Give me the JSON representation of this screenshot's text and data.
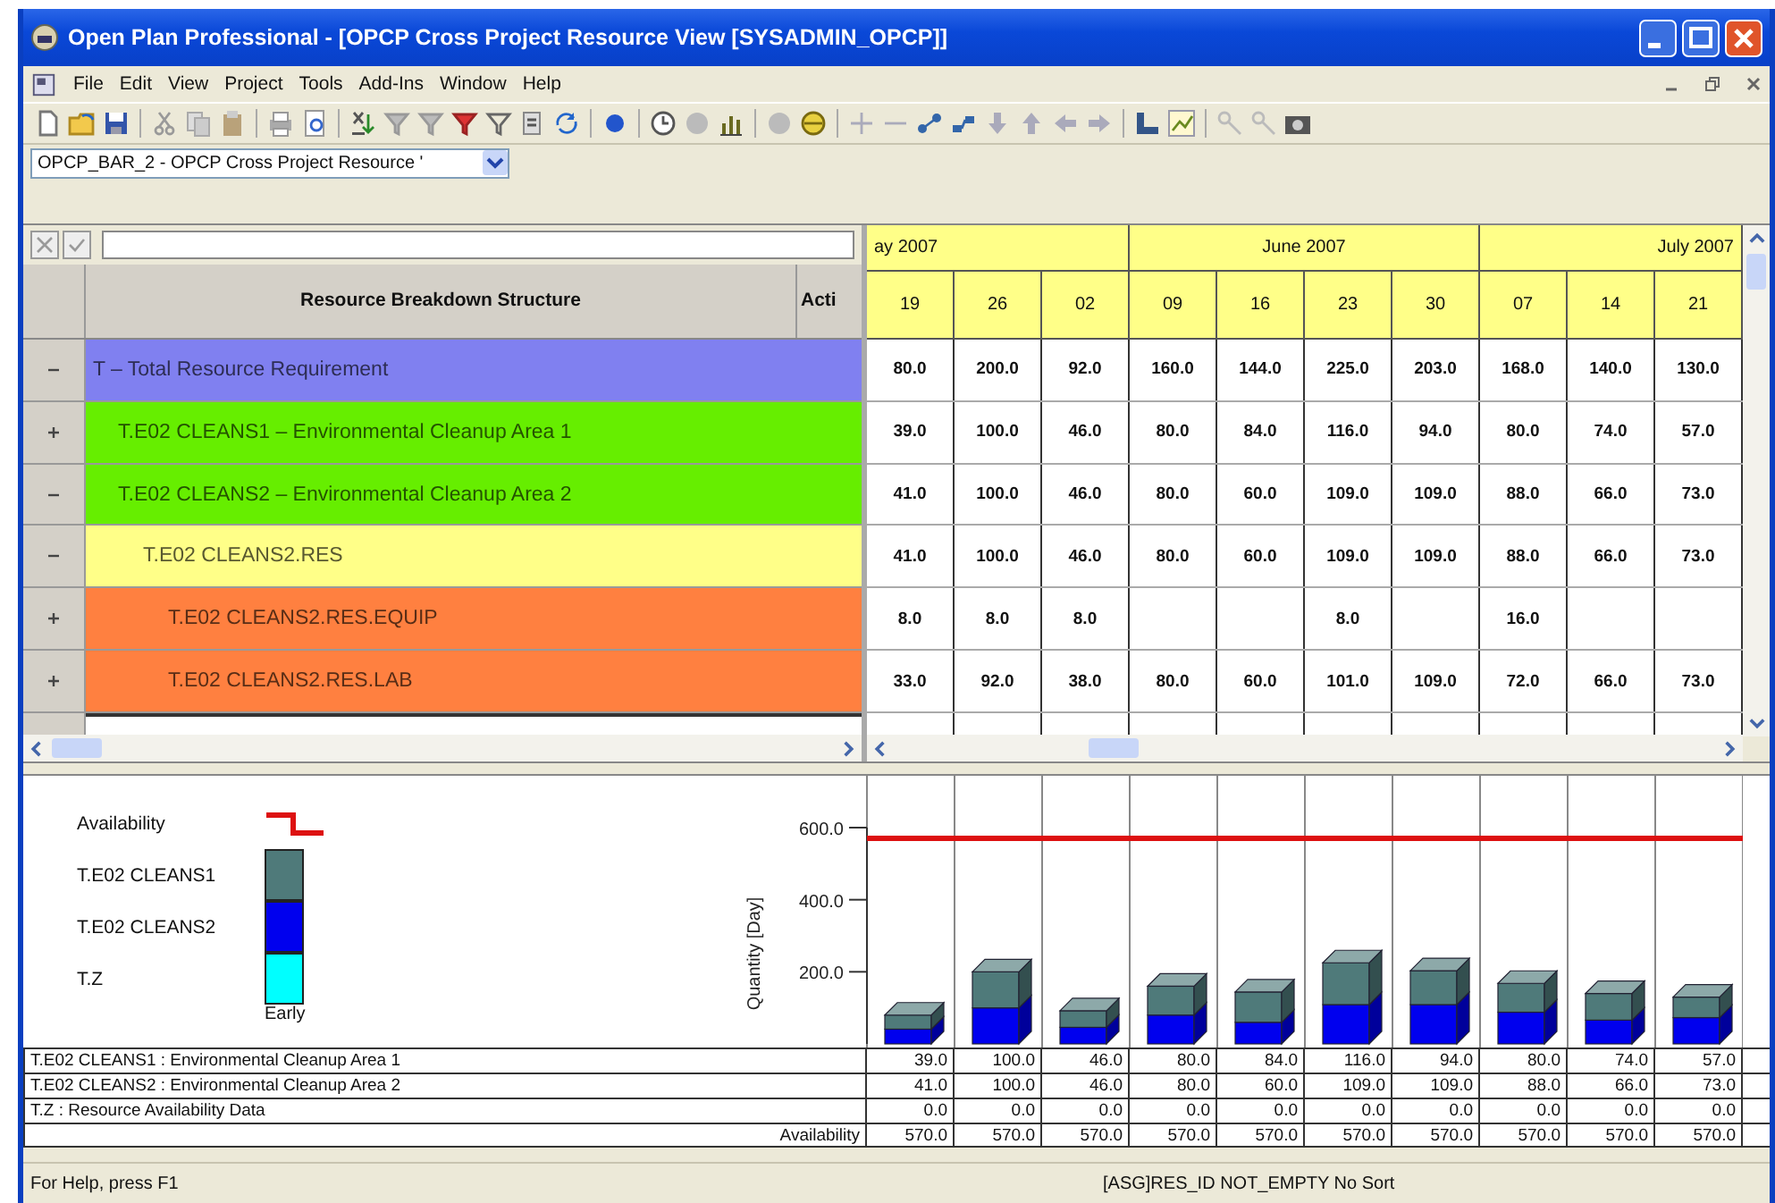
{
  "window": {
    "title": "Open Plan Professional - [OPCP Cross Project Resource View [SYSADMIN_OPCP]]"
  },
  "menu": [
    "File",
    "Edit",
    "View",
    "Project",
    "Tools",
    "Add-Ins",
    "Window",
    "Help"
  ],
  "view_selector": {
    "value": "OPCP_BAR_2 - OPCP Cross Project Resource '"
  },
  "resource_grid": {
    "columns": [
      "Resource Breakdown Structure",
      "Acti"
    ],
    "rows": [
      {
        "label": "T – Total Resource Requirement",
        "color": "#8080f0",
        "expanded": true,
        "values": [
          "80.0",
          "200.0",
          "92.0",
          "160.0",
          "144.0",
          "225.0",
          "203.0",
          "168.0",
          "140.0",
          "130.0"
        ],
        "children": [
          {
            "label": "T.E02 CLEANS1 – Environmental Cleanup Area 1",
            "color": "#66ee00",
            "expanded": false,
            "values": [
              "39.0",
              "100.0",
              "46.0",
              "80.0",
              "84.0",
              "116.0",
              "94.0",
              "80.0",
              "74.0",
              "57.0"
            ]
          },
          {
            "label": "T.E02 CLEANS2 – Environmental Cleanup Area 2",
            "color": "#66ee00",
            "expanded": true,
            "values": [
              "41.0",
              "100.0",
              "46.0",
              "80.0",
              "60.0",
              "109.0",
              "109.0",
              "88.0",
              "66.0",
              "73.0"
            ],
            "children": [
              {
                "label": "T.E02 CLEANS2.RES",
                "color": "#ffff88",
                "expanded": true,
                "values": [
                  "41.0",
                  "100.0",
                  "46.0",
                  "80.0",
                  "60.0",
                  "109.0",
                  "109.0",
                  "88.0",
                  "66.0",
                  "73.0"
                ],
                "children": [
                  {
                    "label": "T.E02 CLEANS2.RES.EQUIP",
                    "color": "#ff8040",
                    "expanded": false,
                    "values": {
                      "0": "8.0",
                      "1": "8.0",
                      "2": "8.0",
                      "5": "8.0",
                      "7": "16.0"
                    }
                  },
                  {
                    "label": "T.E02 CLEANS2.RES.LAB",
                    "color": "#ff8040",
                    "expanded": false,
                    "values": [
                      "33.0",
                      "92.0",
                      "38.0",
                      "80.0",
                      "60.0",
                      "101.0",
                      "109.0",
                      "72.0",
                      "66.0",
                      "73.0"
                    ]
                  }
                ]
              }
            ]
          }
        ]
      }
    ]
  },
  "timescale": {
    "months": [
      {
        "label": "ay 2007",
        "weeks": [
          "19",
          "26",
          "02"
        ]
      },
      {
        "label": "June 2007",
        "weeks": [
          "09",
          "16",
          "23",
          "30"
        ]
      },
      {
        "label": "July 2007",
        "weeks": [
          "07",
          "14",
          "21"
        ]
      }
    ]
  },
  "histogram": {
    "legend_caption": "Early",
    "chart_data": {
      "type": "bar",
      "stacked": true,
      "ylabel": "Quantity [Day]",
      "ylim": [
        0,
        600
      ],
      "yticks": [
        {
          "value": 200,
          "label": "200.0"
        },
        {
          "value": 400,
          "label": "400.0"
        },
        {
          "value": 600,
          "label": "600.0"
        }
      ],
      "ref_lines": [
        {
          "axis": "y",
          "value": 570,
          "label": "Availability",
          "color": "#dd1111"
        }
      ],
      "series": [
        {
          "name": "T.E02 CLEANS1",
          "color": "#4f7a7a",
          "values": [
            39,
            100,
            46,
            80,
            84,
            116,
            94,
            80,
            74,
            57
          ]
        },
        {
          "name": "T.E02 CLEANS2",
          "color": "#0000ee",
          "values": [
            41,
            100,
            46,
            80,
            60,
            109,
            109,
            88,
            66,
            73
          ]
        },
        {
          "name": "T.Z",
          "color": "#00ffff",
          "values": [
            0,
            0,
            0,
            0,
            0,
            0,
            0,
            0,
            0,
            0
          ]
        }
      ]
    },
    "table": [
      {
        "kind": "series",
        "label": "T.E02 CLEANS1 : Environmental Cleanup Area 1",
        "values": [
          "39.0",
          "100.0",
          "46.0",
          "80.0",
          "84.0",
          "116.0",
          "94.0",
          "80.0",
          "74.0",
          "57.0"
        ]
      },
      {
        "kind": "series",
        "label": "T.E02 CLEANS2 : Environmental Cleanup Area 2",
        "values": [
          "41.0",
          "100.0",
          "46.0",
          "80.0",
          "60.0",
          "109.0",
          "109.0",
          "88.0",
          "66.0",
          "73.0"
        ]
      },
      {
        "kind": "series",
        "label": "T.Z : Resource Availability Data",
        "values": [
          "0.0",
          "0.0",
          "0.0",
          "0.0",
          "0.0",
          "0.0",
          "0.0",
          "0.0",
          "0.0",
          "0.0"
        ]
      },
      {
        "kind": "availability",
        "label": "Availability",
        "values": [
          "570.0",
          "570.0",
          "570.0",
          "570.0",
          "570.0",
          "570.0",
          "570.0",
          "570.0",
          "570.0",
          "570.0"
        ]
      }
    ]
  },
  "status_bar": {
    "help": "For Help, press F1",
    "filter": "[ASG]RES_ID NOT_EMPTY No Sort"
  }
}
